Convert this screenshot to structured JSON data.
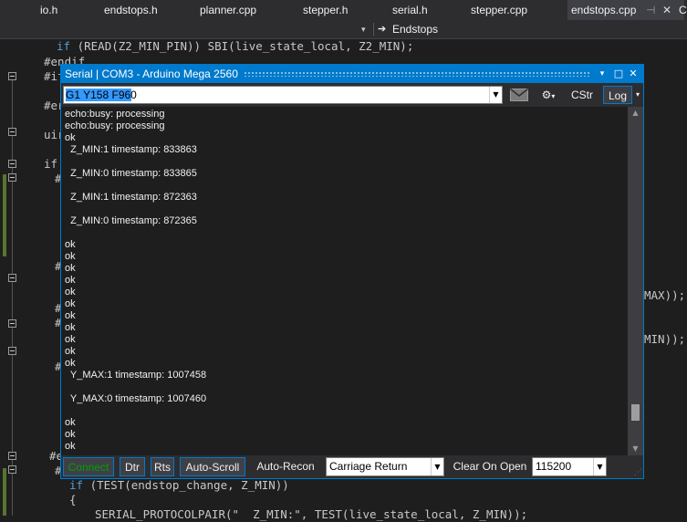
{
  "tabs": [
    {
      "label": "io.h",
      "active": false
    },
    {
      "label": "endstops.h",
      "active": false
    },
    {
      "label": "planner.cpp",
      "active": false
    },
    {
      "label": "stepper.h",
      "active": false
    },
    {
      "label": "serial.h",
      "active": false
    },
    {
      "label": "stepper.cpp",
      "active": false
    },
    {
      "label": "endstops.cpp",
      "active": true
    },
    {
      "label": "C",
      "active": false
    }
  ],
  "nav": {
    "scope": "Endstops"
  },
  "code": {
    "line1_kw": "if",
    "line1_rest": " (READ(Z2_MIN_PIN)) SBI(live_state_local, Z2_MIN);",
    "line2": "#endif",
    "line3": "#if",
    "line4": "#er",
    "line5": "uir",
    "line6": "if",
    "tail_max": "MAX));",
    "tail_min": "MIN));",
    "line_bottom1_kw": "if",
    "line_bottom1_rest": " (TEST(endstop_change, Z_MIN))",
    "line_bottom2": "{",
    "line_bottom3_a": "SERIAL_PROTOCOLPAIR(\"  Z_MIN:\", TEST(live_state_local, Z_MIN));",
    "hash1": "#",
    "hash2": "#",
    "hash3": "#",
    "hash4": "#",
    "hash5": "#",
    "hash6": "#e",
    "hash7": "#"
  },
  "serial": {
    "title": "Serial | COM3   - Arduino Mega 2560",
    "command": "G1 Y158 F960",
    "toolbar": {
      "cstr": "CStr",
      "log": "Log"
    },
    "output_lines": [
      "echo:busy: processing",
      "echo:busy: processing",
      "ok",
      "  Z_MIN:1 timestamp: 833863",
      "",
      "  Z_MIN:0 timestamp: 833865",
      "",
      "  Z_MIN:1 timestamp: 872363",
      "",
      "  Z_MIN:0 timestamp: 872365",
      "",
      "ok",
      "ok",
      "ok",
      "ok",
      "ok",
      "ok",
      "ok",
      "ok",
      "ok",
      "ok",
      "ok",
      "  Y_MAX:1 timestamp: 1007458",
      "",
      "  Y_MAX:0 timestamp: 1007460",
      "",
      "ok",
      "ok",
      "ok"
    ],
    "bottom": {
      "connect": "Connect",
      "dtr": "Dtr",
      "rts": "Rts",
      "autoscroll": "Auto-Scroll",
      "autorecon": "Auto-Recon",
      "line_ending": "Carriage Return",
      "clear_on_open": "Clear On Open",
      "baud": "115200"
    },
    "scroll_position": 0.93
  },
  "colors": {
    "accent": "#007acc",
    "connect_text": "#00a000",
    "editor_bg": "#1e1e1e",
    "change_bar": "#577430"
  }
}
